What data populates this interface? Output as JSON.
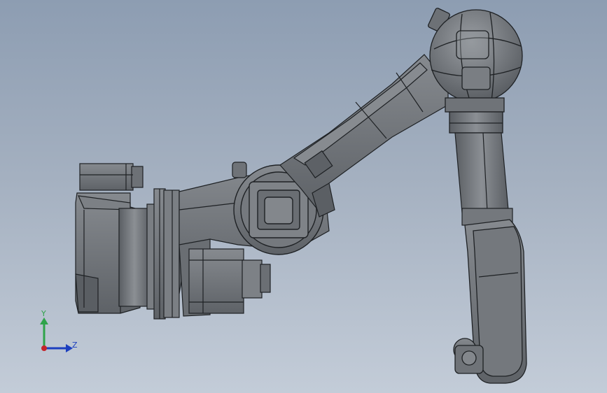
{
  "viewport": {
    "colors": {
      "background_top": "#8d9db2",
      "background_bottom": "#c3ccd8",
      "part_fill": "#6f7378",
      "part_dark": "#4f5358",
      "part_light": "#8a8e93",
      "edge": "#1e2124"
    }
  },
  "triad": {
    "y_label": "Y",
    "z_label": "Z",
    "y_color": "#2fa34a",
    "z_color": "#1c3fbf",
    "x_color": "#c4242b"
  }
}
